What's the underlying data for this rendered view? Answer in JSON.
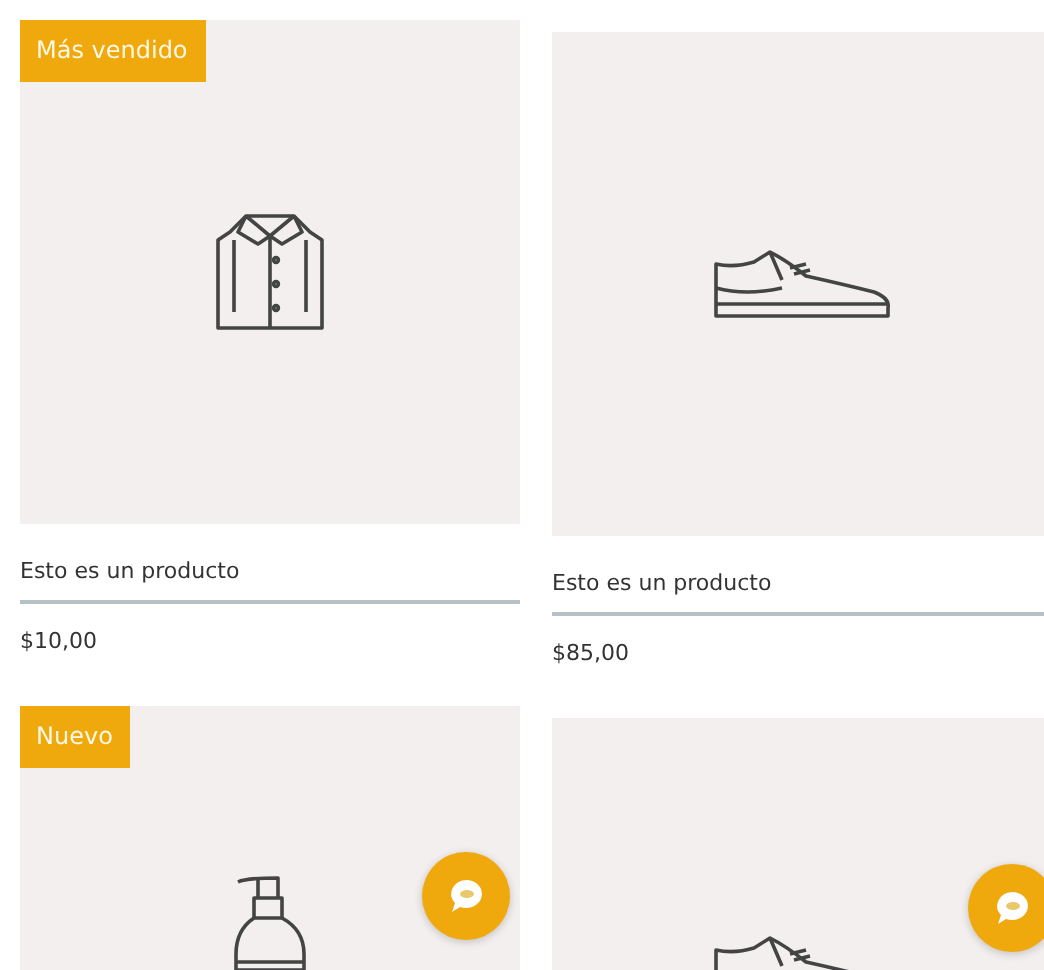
{
  "columns": [
    {
      "products": [
        {
          "kind": "shirt",
          "badge": "Más vendido",
          "name": "Esto es un producto",
          "price": "$10,00"
        },
        {
          "kind": "bottle",
          "badge": "Nuevo"
        }
      ]
    },
    {
      "products": [
        {
          "kind": "shoe",
          "name": "Esto es un producto",
          "price": "$85,00"
        },
        {
          "kind": "shoe"
        }
      ]
    }
  ]
}
